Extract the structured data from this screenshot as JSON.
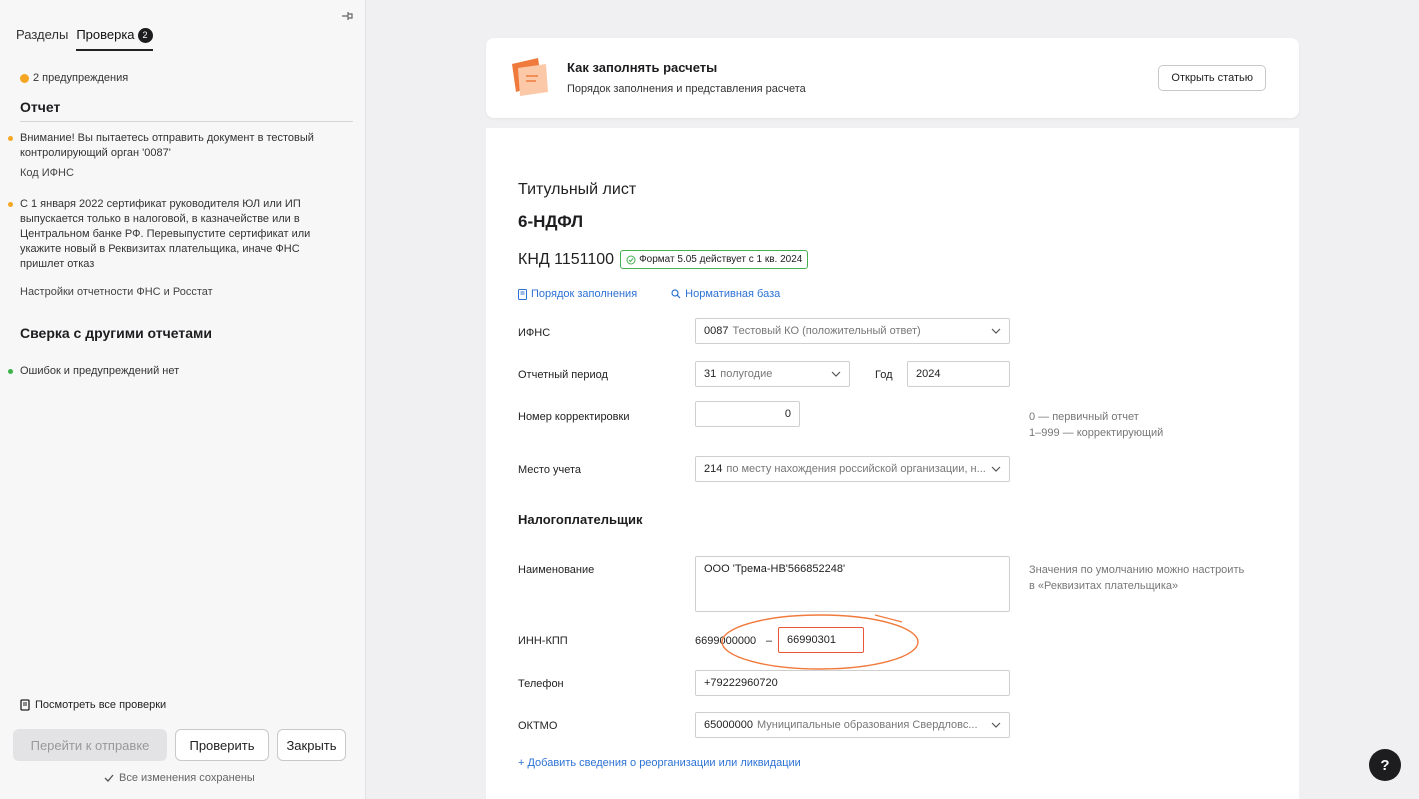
{
  "sidebar": {
    "tabs": [
      {
        "label": "Разделы"
      },
      {
        "label": "Проверка",
        "badge": "2"
      }
    ],
    "warnings_summary": "2 предупреждения",
    "report_title": "Отчет",
    "messages": [
      {
        "text": "Внимание! Вы пытаетесь отправить документ в тестовый контролирующий орган '0087'",
        "link": "Код ИФНС"
      },
      {
        "text": "С 1 января 2022 сертификат руководителя ЮЛ или ИП выпускается только в налоговой, в казначействе или в Центральном банке РФ. Перевыпустите сертификат или укажите новый в Реквизитах плательщика, иначе ФНС пришлет отказ",
        "link": "Настройки отчетности ФНС и Росстат"
      }
    ],
    "compare_title": "Сверка с другими отчетами",
    "compare_ok": "Ошибок и предупреждений нет",
    "view_all": "Посмотреть все проверки",
    "buttons": {
      "send": "Перейти к отправке",
      "check": "Проверить",
      "close": "Закрыть"
    },
    "saved": "Все изменения сохранены"
  },
  "info_card": {
    "title": "Как заполнять расчеты",
    "subtitle": "Порядок заполнения и представления расчета",
    "button": "Открыть статью"
  },
  "form": {
    "sheet_title": "Титульный лист",
    "form_name": "6-НДФЛ",
    "knd": "КНД 1151100",
    "format_badge": "Формат 5.05 действует с 1 кв. 2024",
    "links": {
      "order": "Порядок заполнения",
      "regulatory": "Нормативная база"
    },
    "ifns": {
      "label": "ИФНС",
      "code": "0087",
      "name": "Тестовый КО (положительный ответ)"
    },
    "period": {
      "label": "Отчетный период",
      "code": "31",
      "name": "полугодие",
      "year_label": "Год",
      "year": "2024"
    },
    "correction": {
      "label": "Номер корректировки",
      "value": "0",
      "hint1": "0 — первичный отчет",
      "hint2": "1–999 — корректирующий"
    },
    "place": {
      "label": "Место учета",
      "code": "214",
      "name": "по месту нахождения российской организации, н..."
    },
    "taxpayer_title": "Налогоплательщик",
    "name": {
      "label": "Наименование",
      "value": "ООО 'Трема-НВ'566852248'",
      "hint1": "Значения по умолчанию можно настроить",
      "hint2": "в «Реквизитах плательщика»"
    },
    "inn_kpp": {
      "label": "ИНН-КПП",
      "inn": "6699000000",
      "dash": "–",
      "kpp": "66990301"
    },
    "phone": {
      "label": "Телефон",
      "value": "+79222960720"
    },
    "oktmo": {
      "label": "ОКТМО",
      "code": "65000000",
      "name": "Муниципальные образования Свердловс..."
    },
    "add_reorg": "+ Добавить сведения о реорганизации или ликвидации"
  },
  "help": "?",
  "colors": {
    "accent_link": "#2c72d4",
    "warning": "#f5a623",
    "ok": "#3cb34a",
    "highlight": "#f07a3c"
  }
}
